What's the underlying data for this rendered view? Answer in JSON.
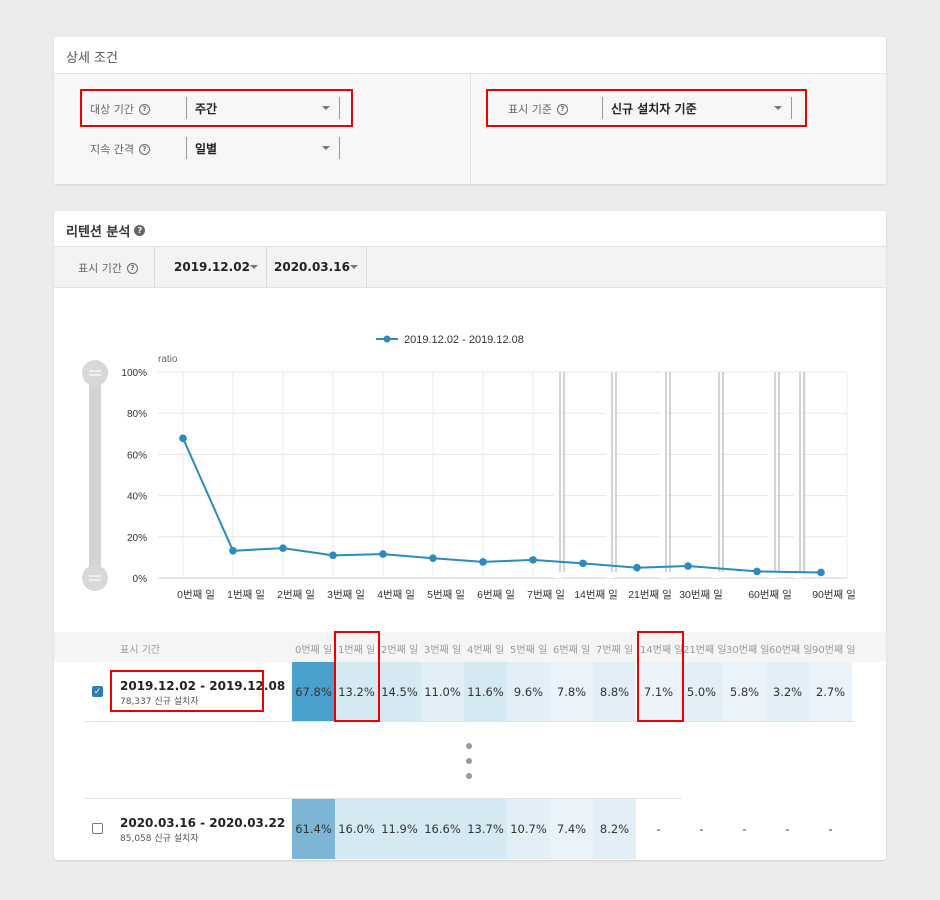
{
  "conditions": {
    "title": "상세 조건",
    "target_period": {
      "label": "대상 기간",
      "value": "주간"
    },
    "duration_interval": {
      "label": "지속 간격",
      "value": "일별"
    },
    "display_basis": {
      "label": "표시 기준",
      "value": "신규 설치자 기준"
    }
  },
  "retention": {
    "title": "리텐션 분석",
    "display_period_label": "표시 기간",
    "start_date": "2019.12.02",
    "end_date": "2020.03.16"
  },
  "chart_data": {
    "type": "line",
    "ylabel": "ratio",
    "ylim": [
      0,
      100
    ],
    "y_ticks": [
      "100%",
      "80%",
      "60%",
      "40%",
      "20%",
      "0%"
    ],
    "categories": [
      "0번째 일",
      "1번째 일",
      "2번째 일",
      "3번째 일",
      "4번째 일",
      "5번째 일",
      "6번째 일",
      "7번째 일",
      "14번째 일",
      "21번째 일",
      "30번째 일",
      "60번째 일",
      "90번째 일"
    ],
    "series": [
      {
        "name": "2019.12.02 - 2019.12.08",
        "values": [
          67.8,
          13.2,
          14.5,
          11.0,
          11.6,
          9.6,
          7.8,
          8.8,
          7.1,
          5.0,
          5.8,
          3.2,
          2.7
        ]
      }
    ],
    "legend": "top-center",
    "grid": true,
    "series_color": "#2a8bc0"
  },
  "table": {
    "period_header": "표시 기간",
    "day_headers": [
      "0번째 일",
      "1번째 일",
      "2번째 일",
      "3번째 일",
      "4번째 일",
      "5번째 일",
      "6번째 일",
      "7번째 일",
      "14번째 일",
      "21번째 일",
      "30번째 일",
      "60번째 일",
      "90번째 일"
    ],
    "rows": [
      {
        "period": "2019.12.02 - 2019.12.08",
        "installs": "78,337 신규 설치자",
        "checked": true,
        "cells": [
          "67.8%",
          "13.2%",
          "14.5%",
          "11.0%",
          "11.6%",
          "9.6%",
          "7.8%",
          "8.8%",
          "7.1%",
          "5.0%",
          "5.8%",
          "3.2%",
          "2.7%"
        ]
      },
      {
        "period": "2020.03.16 - 2020.03.22",
        "installs": "85,058 신규 설치자",
        "checked": false,
        "cells": [
          "61.4%",
          "16.0%",
          "11.9%",
          "16.6%",
          "13.7%",
          "10.7%",
          "7.4%",
          "8.2%",
          "-",
          "-",
          "-",
          "-",
          "-"
        ]
      }
    ]
  }
}
